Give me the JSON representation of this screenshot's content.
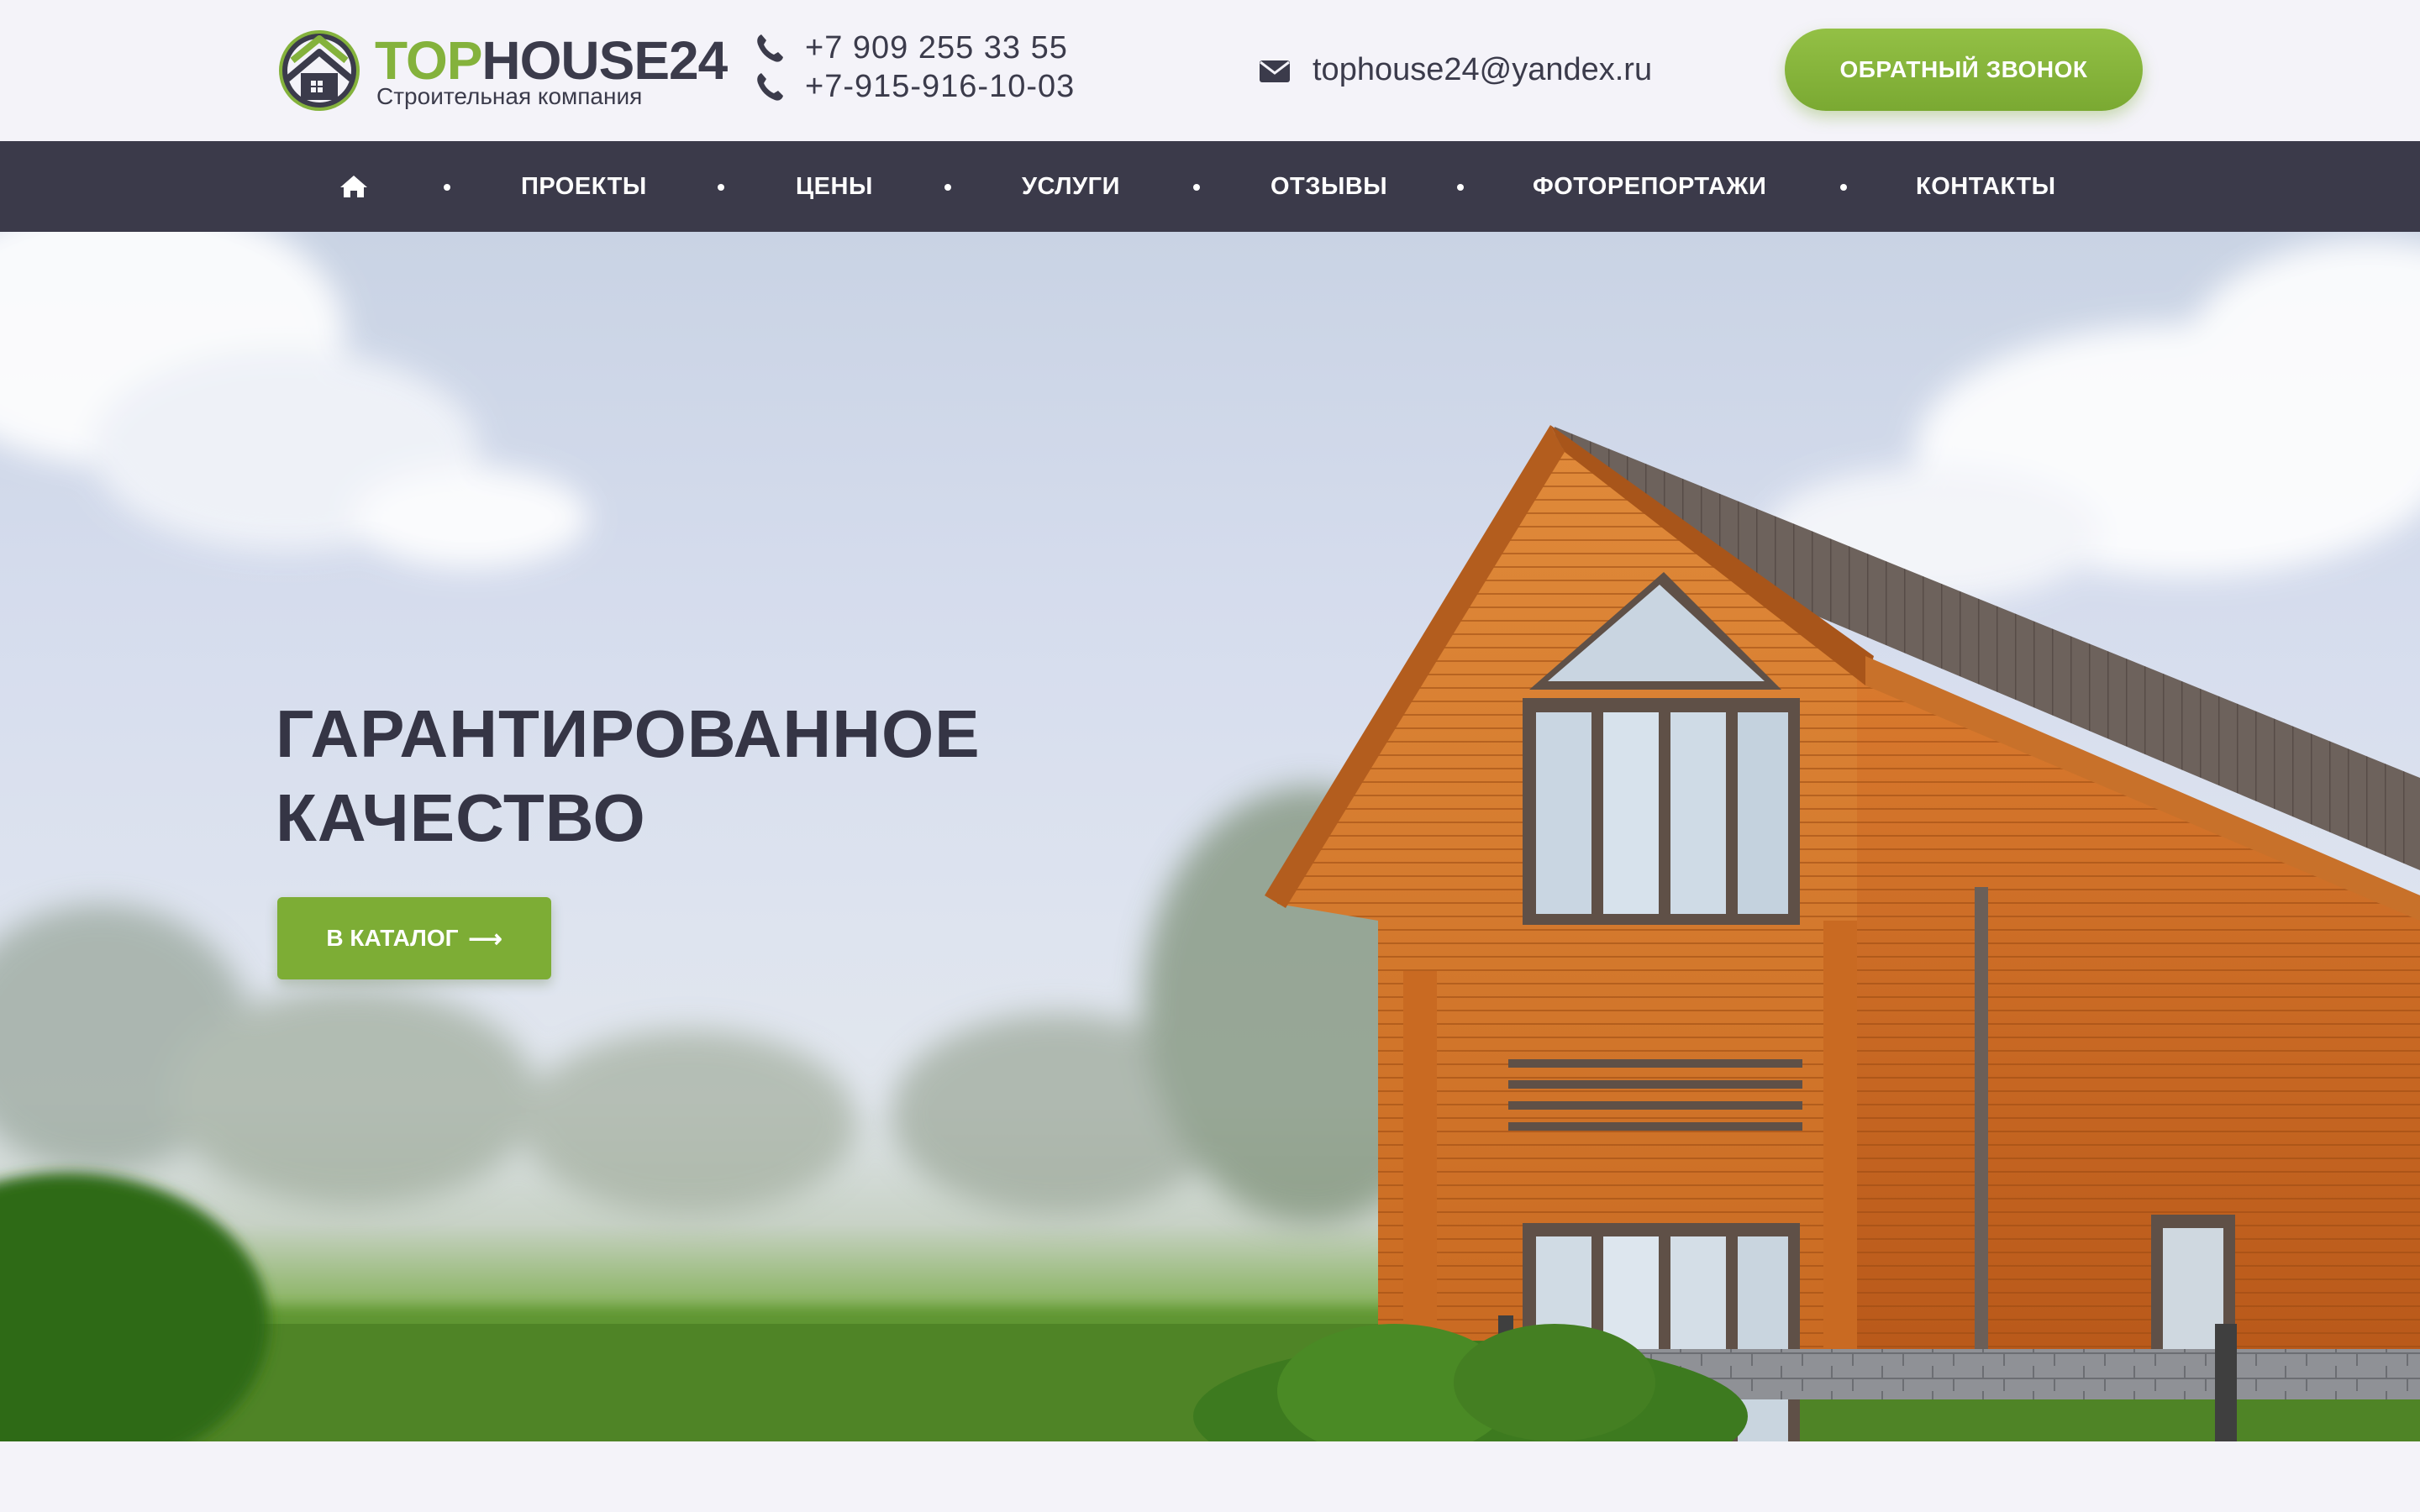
{
  "header": {
    "logo": {
      "word_part1": "TOP",
      "word_part2": "HOUSE24",
      "subtitle": "Строительная компания"
    },
    "phones": [
      "+7 909 255 33 55",
      "+7-915-916-10-03"
    ],
    "phone_icon": "phone-icon",
    "email": "tophouse24@yandex.ru",
    "email_icon": "envelope-icon",
    "callback_label": "ОБРАТНЫЙ ЗВОНОК"
  },
  "nav": {
    "home_icon": "home-icon",
    "items": [
      {
        "label": "ПРОЕКТЫ"
      },
      {
        "label": "ЦЕНЫ"
      },
      {
        "label": "УСЛУГИ"
      },
      {
        "label": "ОТЗЫВЫ"
      },
      {
        "label": "ФОТОРЕПОРТАЖИ"
      },
      {
        "label": "КОНТАКТЫ"
      }
    ]
  },
  "hero": {
    "title_line1": "ГАРАНТИРОВАННОЕ",
    "title_line2": "КАЧЕСТВО",
    "catalog_label": "В КАТАЛОГ",
    "catalog_arrow": "⟶"
  },
  "colors": {
    "accent_green": "#7dad35",
    "nav_dark": "#3b3a4a",
    "text_dark": "#353545",
    "page_bg": "#f4f3f9"
  }
}
